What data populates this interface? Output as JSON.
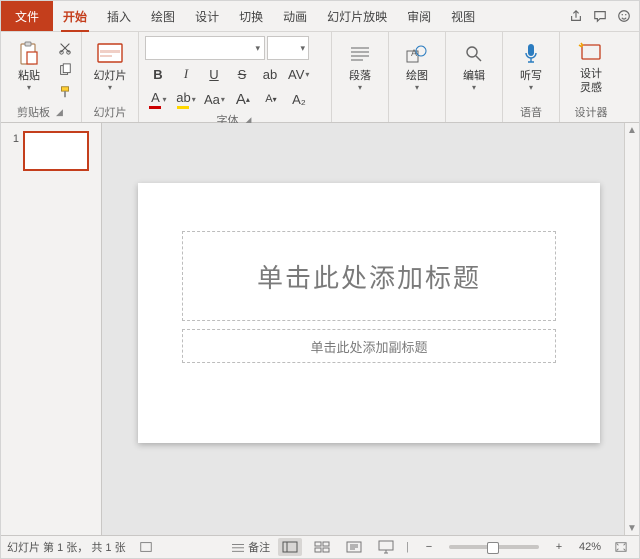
{
  "tabs": {
    "file": "文件",
    "home": "开始",
    "insert": "插入",
    "draw": "绘图",
    "design": "设计",
    "transitions": "切换",
    "animations": "动画",
    "slideshow": "幻灯片放映",
    "review": "审阅",
    "view": "视图"
  },
  "ribbon": {
    "clipboard": {
      "label": "剪贴板",
      "paste": "粘贴"
    },
    "slides": {
      "label": "幻灯片",
      "slide": "幻灯片"
    },
    "font": {
      "label": "字体",
      "name_placeholder": "",
      "size_placeholder": "",
      "bold": "B",
      "italic": "I",
      "underline": "U",
      "strike": "S",
      "shadow": "ab",
      "spacing": "AV",
      "fontcolor": "A",
      "highlight": "ab",
      "fontbox": "Aa",
      "grow": "A",
      "shrink": "A",
      "clear": "A₂"
    },
    "paragraph": {
      "label": "段落"
    },
    "drawing": {
      "label": "绘图"
    },
    "editing": {
      "label": "编辑"
    },
    "voice": {
      "label": "语音",
      "dictate": "听写"
    },
    "designer": {
      "label": "设计器",
      "ideas_l1": "设计",
      "ideas_l2": "灵感"
    }
  },
  "thumbs": {
    "n1": "1"
  },
  "slide": {
    "title_placeholder": "单击此处添加标题",
    "subtitle_placeholder": "单击此处添加副标题"
  },
  "status": {
    "slide_info": "幻灯片 第 1 张， 共 1 张",
    "notes": "备注",
    "zoom_label": "42%",
    "zoom_minus": "−",
    "zoom_plus": "+"
  }
}
